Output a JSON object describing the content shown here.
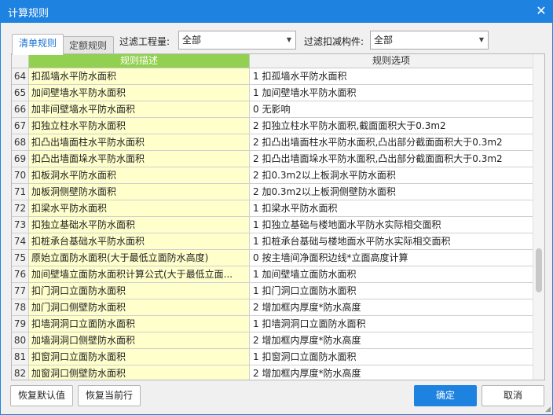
{
  "window": {
    "title": "计算规则",
    "close_symbol": "✕"
  },
  "tabs": [
    {
      "label": "清单规则",
      "active": true
    },
    {
      "label": "定额规则",
      "active": false
    }
  ],
  "filters": {
    "project_label": "过滤工程量:",
    "project_value": "全部",
    "component_label": "过滤扣减构件:",
    "component_value": "全部"
  },
  "table": {
    "columns": [
      "",
      "规则描述",
      "规则选项"
    ],
    "rows": [
      {
        "num": "64",
        "desc": "扣孤墙水平防水面积",
        "option": "1 扣孤墙水平防水面积"
      },
      {
        "num": "65",
        "desc": "加间壁墙水平防水面积",
        "option": "1 加间壁墙水平防水面积"
      },
      {
        "num": "66",
        "desc": "加非间壁墙水平防水面积",
        "option": "0  无影响"
      },
      {
        "num": "67",
        "desc": "扣独立柱水平防水面积",
        "option": "2 扣独立柱水平防水面积,截面面积大于0.3m2"
      },
      {
        "num": "68",
        "desc": "扣凸出墙面柱水平防水面积",
        "option": "2 扣凸出墙面柱水平防水面积,凸出部分截面面积大于0.3m2"
      },
      {
        "num": "69",
        "desc": "扣凸出墙面垛水平防水面积",
        "option": "2 扣凸出墙面垛水平防水面积,凸出部分截面面积大于0.3m2"
      },
      {
        "num": "70",
        "desc": "扣板洞水平防水面积",
        "option": "2 扣0.3m2以上板洞水平防水面积"
      },
      {
        "num": "71",
        "desc": "加板洞侧壁防水面积",
        "option": "2 加0.3m2以上板洞侧壁防水面积"
      },
      {
        "num": "72",
        "desc": "扣梁水平防水面积",
        "option": "1 扣梁水平防水面积"
      },
      {
        "num": "73",
        "desc": "扣独立基础水平防水面积",
        "option": "1 扣独立基础与楼地面水平防水实际相交面积"
      },
      {
        "num": "74",
        "desc": "扣桩承台基础水平防水面积",
        "option": "1 扣桩承台基础与楼地面水平防水实际相交面积"
      },
      {
        "num": "75",
        "desc": "原始立面防水面积(大于最低立面防水高度)",
        "option": "0 按主墙间净面积边线*立面高度计算"
      },
      {
        "num": "76",
        "desc": "加间壁墙立面防水面积计算公式(大于最低立面...",
        "option": "1 加间壁墙立面防水面积"
      },
      {
        "num": "77",
        "desc": "扣门洞口立面防水面积",
        "option": "1 扣门洞口立面防水面积"
      },
      {
        "num": "78",
        "desc": "加门洞口侧壁防水面积",
        "option": "2 增加框内厚度*防水高度"
      },
      {
        "num": "79",
        "desc": "扣墙洞洞口立面防水面积",
        "option": "1 扣墙洞洞口立面防水面积"
      },
      {
        "num": "80",
        "desc": "加墙洞洞口侧壁防水面积",
        "option": "2 增加框内厚度*防水高度"
      },
      {
        "num": "81",
        "desc": "扣窗洞口立面防水面积",
        "option": "1 扣窗洞口立面防水面积"
      },
      {
        "num": "82",
        "desc": "加窗洞口侧壁防水面积",
        "option": "2 增加框内厚度*防水高度"
      }
    ]
  },
  "footer": {
    "restore_default": "恢复默认值",
    "restore_current": "恢复当前行",
    "ok": "确定",
    "cancel": "取消"
  },
  "colors": {
    "titlebar": "#1e82e0",
    "header_accent": "#92d050",
    "desc_bg": "#ffffcc"
  },
  "icons": {
    "close": "close-icon",
    "dropdown": "chevron-down-icon"
  }
}
